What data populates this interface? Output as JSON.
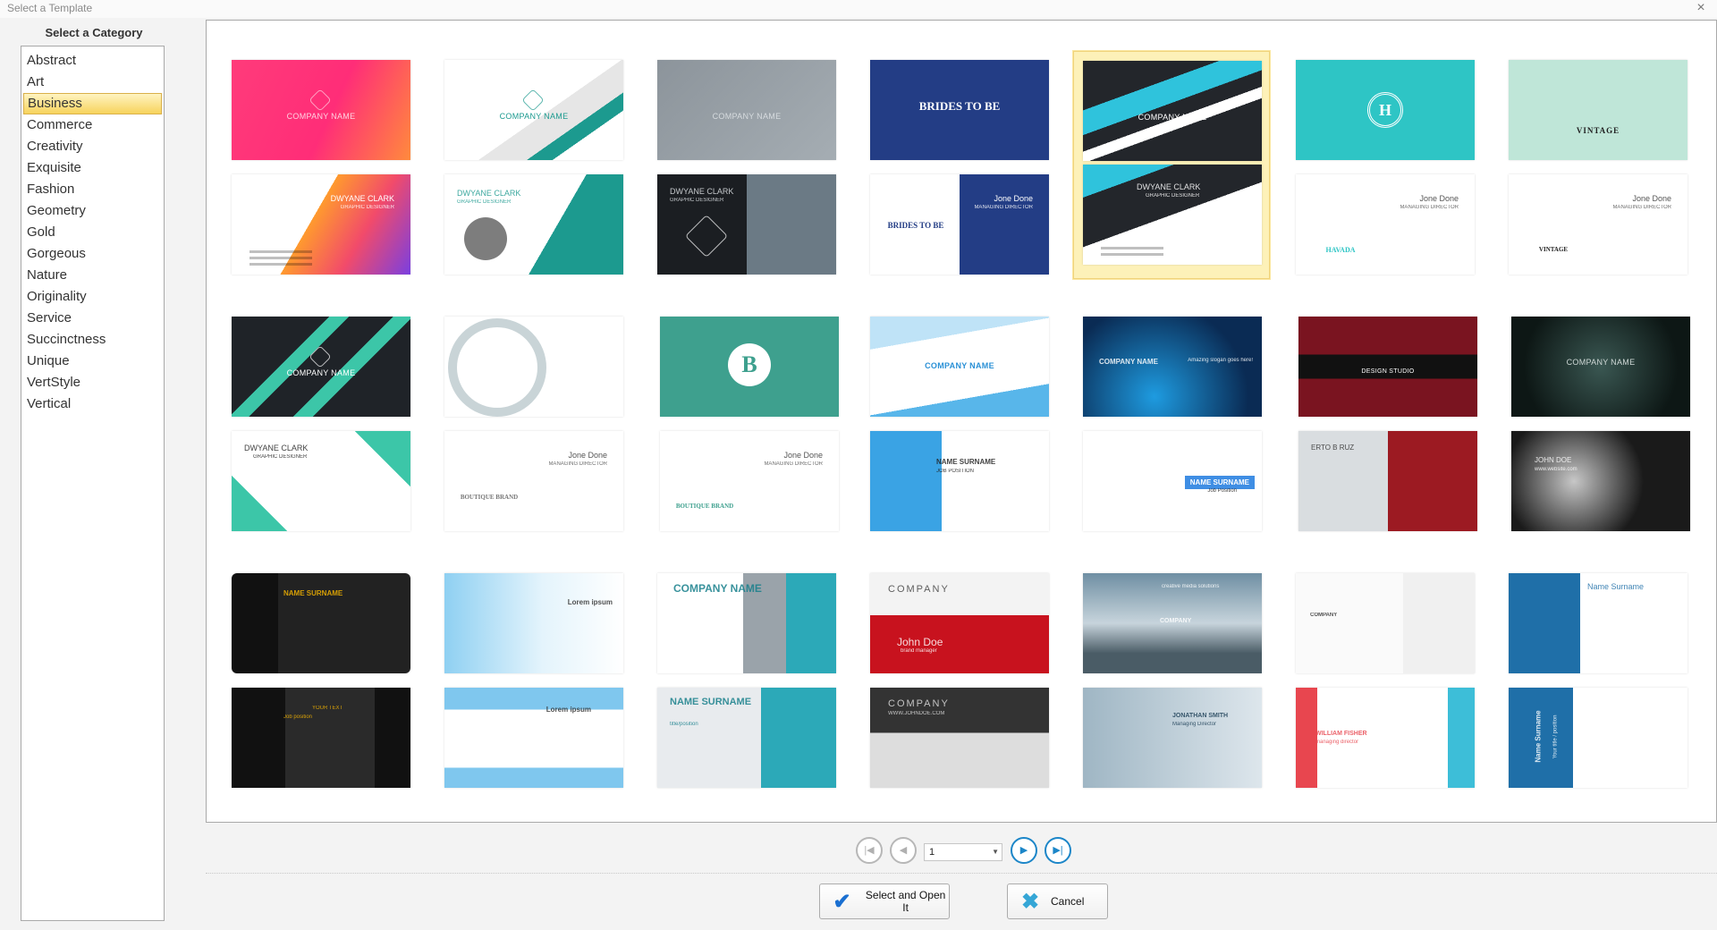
{
  "window": {
    "title": "Select a Template",
    "close_label": "×"
  },
  "categories": {
    "heading": "Select a Category",
    "selected": "Business",
    "items": [
      "Abstract",
      "Art",
      "Business",
      "Commerce",
      "Creativity",
      "Exquisite",
      "Fashion",
      "Geometry",
      "Gold",
      "Gorgeous",
      "Nature",
      "Originality",
      "Service",
      "Succinctness",
      "Unique",
      "VertStyle",
      "Vertical"
    ]
  },
  "templates": [
    [
      {
        "front": "COMPANY NAME",
        "back": "DWYANE CLARK",
        "back_sub": "GRAPHIC DESIGNER"
      },
      {
        "front": "COMPANY NAME",
        "back": "DWYANE CLARK",
        "back_sub": "GRAPHIC DESIGNER"
      },
      {
        "front": "COMPANY NAME",
        "back": "DWYANE CLARK",
        "back_sub": "GRAPHIC DESIGNER"
      },
      {
        "front": "BRIDES TO BE",
        "back": "Jone Done",
        "back_sub": "MANAGING DIRECTOR",
        "back_emblem": "BRIDES TO BE"
      },
      {
        "front": "COMPANY NAME",
        "back": "DWYANE CLARK",
        "back_sub": "GRAPHIC DESIGNER",
        "selected": true
      },
      {
        "front": "H",
        "back": "Jone Done",
        "back_sub": "MANAGING DIRECTOR",
        "back_emblem": "HAVADA"
      },
      {
        "front": "VINTAGE",
        "back": "Jone Done",
        "back_sub": "MANAGING DIRECTOR",
        "back_emblem": "VINTAGE"
      }
    ],
    [
      {
        "front": "COMPANY NAME",
        "back": "DWYANE CLARK",
        "back_sub": "GRAPHIC DESIGNER"
      },
      {
        "front": "",
        "back": "Jone Done",
        "back_sub": "MANAGING DIRECTOR",
        "back_emblem": "BOUTIQUE BRAND"
      },
      {
        "front": "B",
        "back": "Jone Done",
        "back_sub": "MANAGING DIRECTOR",
        "back_emblem": "BOUTIQUE BRAND"
      },
      {
        "front": "COMPANY NAME",
        "back": "NAME SURNAME",
        "back_sub": "JOB POSITION"
      },
      {
        "front": "COMPANY NAME",
        "back": "NAME SURNAME",
        "back_sub": "Job Position",
        "front_slogan": "Amazing slogan goes here!"
      },
      {
        "front": "DESIGN STUDIO",
        "back": "ERTO B RUZ",
        "back_sub": ""
      },
      {
        "front": "COMPANY NAME",
        "back": "JOHN DOE",
        "back_sub": "www.website.com"
      }
    ],
    [
      {
        "front": "NAME SURNAME",
        "back": "YOUR TEXT",
        "back_sub": "Job position"
      },
      {
        "front": "Lorem ipsum",
        "back": "Lorem ipsum",
        "back_sub": ""
      },
      {
        "front": "COMPANY NAME",
        "back": "NAME SURNAME",
        "back_sub": "title/position"
      },
      {
        "front": "COMPANY",
        "back": "COMPANY",
        "back_sub": "WWW.JOHNDOE.COM",
        "front_person": "John Doe",
        "front_role": "brand manager"
      },
      {
        "front": "COMPANY",
        "back": "JONATHAN SMITH",
        "back_sub": "Managing Director",
        "front_slogan": "creative media solutions"
      },
      {
        "front": "COMPANY",
        "back": "WILLIAM FISHER",
        "back_sub": "managing director"
      },
      {
        "front": "Name Surname",
        "back": "Name Surname",
        "back_sub": "Your title / position"
      }
    ]
  ],
  "pagination": {
    "first": "|◀",
    "prev": "◀",
    "page": "1",
    "next": "▶",
    "last": "▶|"
  },
  "buttons": {
    "ok_label": "Select and Open It",
    "ok_icon": "✔",
    "cancel_label": "Cancel",
    "cancel_icon": "✖"
  },
  "colors": {
    "selection": "#f7d35c",
    "accent": "#1c86c8",
    "ok_icon": "#1a6fd1",
    "cancel_icon": "#35a6d6"
  }
}
